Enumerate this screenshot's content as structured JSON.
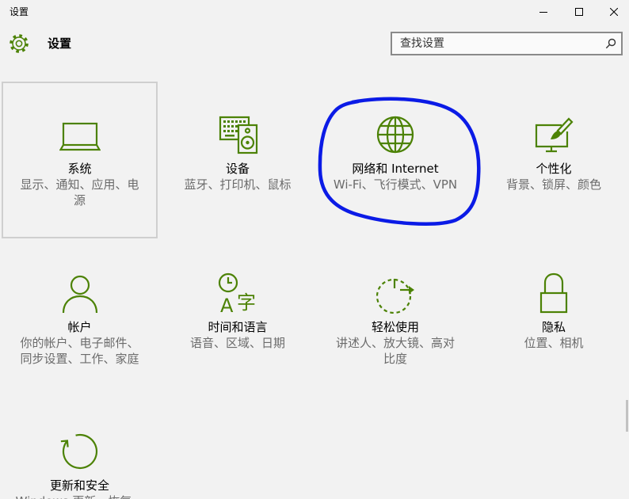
{
  "window": {
    "title": "设置",
    "controls": {
      "minimize": "minimize-icon",
      "maximize": "maximize-icon",
      "close": "close-icon"
    }
  },
  "header": {
    "title": "设置",
    "icon": "gear-icon"
  },
  "search": {
    "placeholder": "查找设置",
    "icon": "search-icon"
  },
  "tiles": [
    {
      "title": "系统",
      "description": "显示、通知、应用、电源",
      "icon": "laptop-icon",
      "selected": true
    },
    {
      "title": "设备",
      "description": "蓝牙、打印机、鼠标",
      "icon": "devices-icon"
    },
    {
      "title": "网络和 Internet",
      "description": "Wi-Fi、飞行模式、VPN",
      "icon": "globe-icon"
    },
    {
      "title": "个性化",
      "description": "背景、锁屏、颜色",
      "icon": "personalization-icon"
    },
    {
      "title": "帐户",
      "description": "你的帐户、电子邮件、同步设置、工作、家庭",
      "icon": "person-icon"
    },
    {
      "title": "时间和语言",
      "description": "语音、区域、日期",
      "icon": "clock-language-icon",
      "icon_glyphs": [
        "A",
        "字"
      ]
    },
    {
      "title": "轻松使用",
      "description": "讲述人、放大镜、高对比度",
      "icon": "ease-of-access-icon"
    },
    {
      "title": "隐私",
      "description": "位置、相机",
      "icon": "lock-icon"
    },
    {
      "title": "更新和安全",
      "description": "Windows 更新、恢复、备份",
      "icon": "update-icon"
    }
  ],
  "colors": {
    "accent": "#4c8205",
    "background": "#f2f2f2",
    "text": "#000000",
    "description": "#6b6b6b",
    "selected_border": "#cfcfcf",
    "annotation": "#0b1be6",
    "search_border": "#8a8a8a",
    "search_background": "#fafafa"
  }
}
